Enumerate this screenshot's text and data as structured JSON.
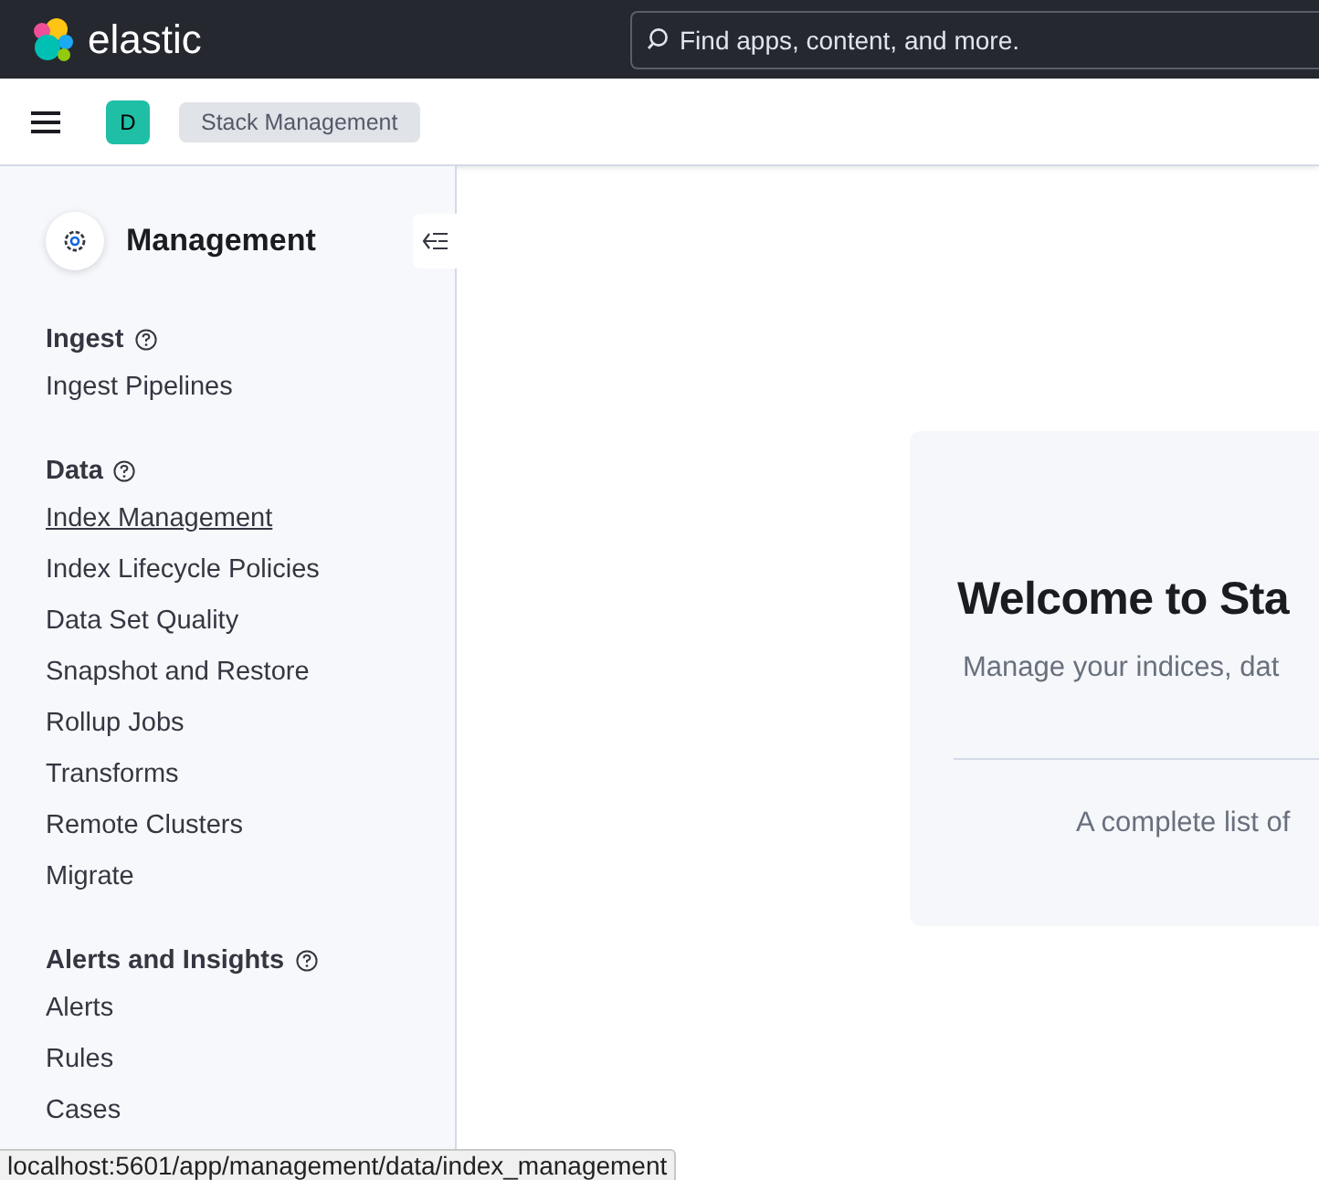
{
  "header": {
    "brand": "elastic",
    "search": {
      "placeholder": "Find apps, content, and more."
    }
  },
  "subheader": {
    "space": "D",
    "breadcrumb": "Stack Management"
  },
  "sidebar": {
    "title": "Management",
    "sections": [
      {
        "heading": "Ingest",
        "items": [
          {
            "label": "Ingest Pipelines",
            "hovered": false
          }
        ]
      },
      {
        "heading": "Data",
        "items": [
          {
            "label": "Index Management",
            "hovered": true
          },
          {
            "label": "Index Lifecycle Policies",
            "hovered": false
          },
          {
            "label": "Data Set Quality",
            "hovered": false
          },
          {
            "label": "Snapshot and Restore",
            "hovered": false
          },
          {
            "label": "Rollup Jobs",
            "hovered": false
          },
          {
            "label": "Transforms",
            "hovered": false
          },
          {
            "label": "Remote Clusters",
            "hovered": false
          },
          {
            "label": "Migrate",
            "hovered": false
          }
        ]
      },
      {
        "heading": "Alerts and Insights",
        "items": [
          {
            "label": "Alerts",
            "hovered": false
          },
          {
            "label": "Rules",
            "hovered": false
          },
          {
            "label": "Cases",
            "hovered": false
          }
        ]
      }
    ]
  },
  "welcome": {
    "title": "Welcome to Sta",
    "subtitle": "Manage your indices, dat",
    "footer": "A complete list of"
  },
  "status_bar": "localhost:5601/app/management/data/index_management"
}
